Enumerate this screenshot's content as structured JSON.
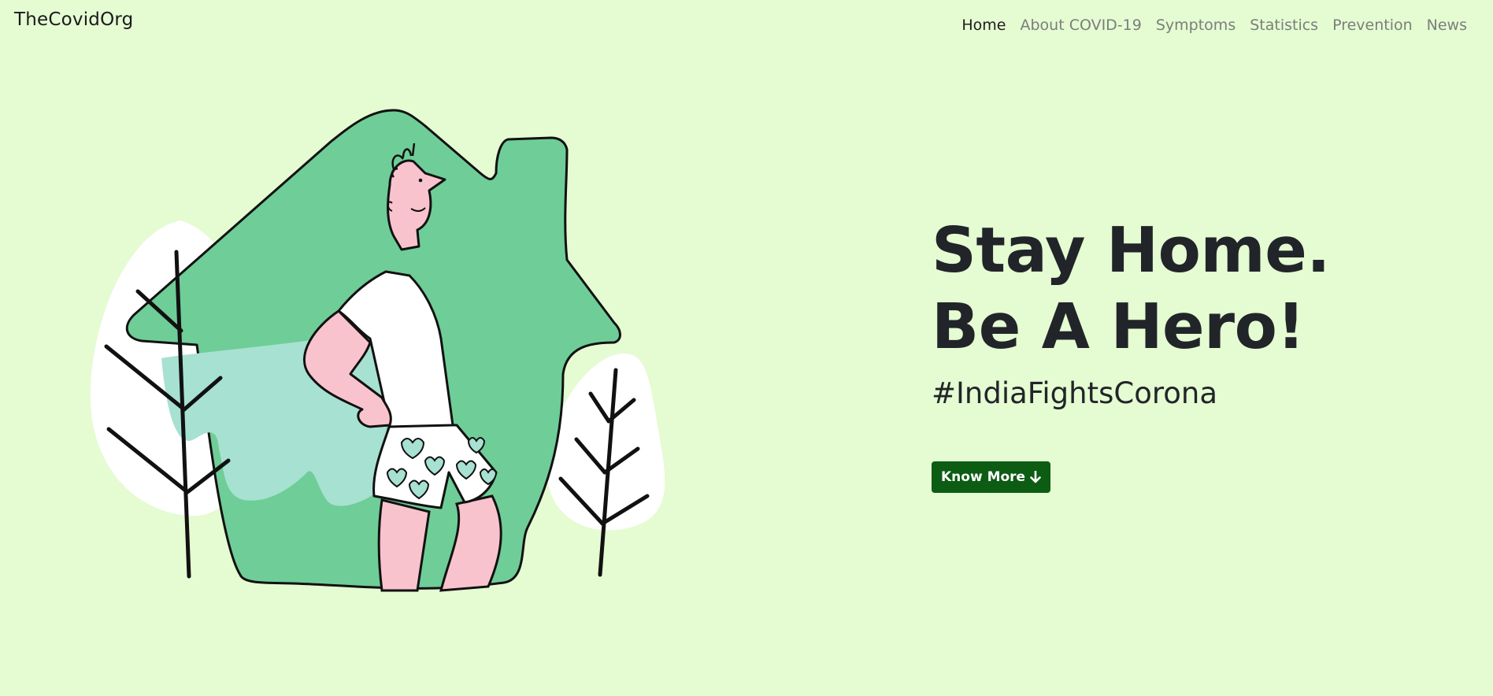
{
  "brand": "TheCovidOrg",
  "nav": {
    "items": [
      "Home",
      "About COVID-19",
      "Symptoms",
      "Statistics",
      "Prevention",
      "News"
    ],
    "active": "Home"
  },
  "hero": {
    "title_line1": "Stay Home.",
    "title_line2": "Be A Hero!",
    "hashtag": "#IndiaFightsCorona",
    "button_label": "Know More",
    "button_icon": "arrow-down-icon"
  },
  "colors": {
    "background": "#e5fbd2",
    "house_green": "#6fcd97",
    "cape_mint": "#a7e1d1",
    "skin_pink": "#f9c3cd",
    "button": "#0c5c14"
  }
}
